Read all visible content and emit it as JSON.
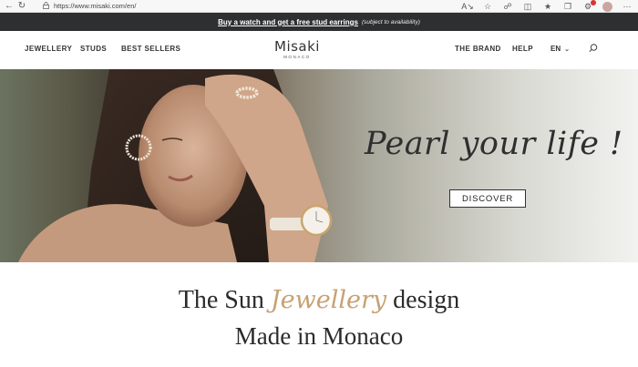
{
  "browser": {
    "url": "https://www.misaki.com/en/",
    "icons": [
      "back-icon",
      "refresh-icon",
      "lock-icon",
      "read-aloud-icon",
      "favorite-icon",
      "extension-icon",
      "split-screen-icon",
      "favorites-bar-icon",
      "collections-icon",
      "profile-avatar",
      "more-icon"
    ]
  },
  "promo": {
    "link_text": "Buy a watch and get a free stud earrings",
    "note": "(subject to availability)"
  },
  "header": {
    "nav_left": [
      "JEWELLERY",
      "STUDS",
      "BEST SELLERS"
    ],
    "logo": "Misaki",
    "logo_sub": "MONACO",
    "nav_right": [
      "THE BRAND",
      "HELP"
    ],
    "language": "EN"
  },
  "hero": {
    "tagline": "Pearl your life !",
    "cta": "DISCOVER"
  },
  "intro": {
    "line1_before": "The Sun",
    "line1_accent": "Jewellery",
    "line1_after": "design",
    "line2": "Made in Monaco"
  },
  "colors": {
    "promo_bg": "#2e2f31",
    "accent_gold": "#c7a171",
    "text_dark": "#2b2b2b"
  }
}
